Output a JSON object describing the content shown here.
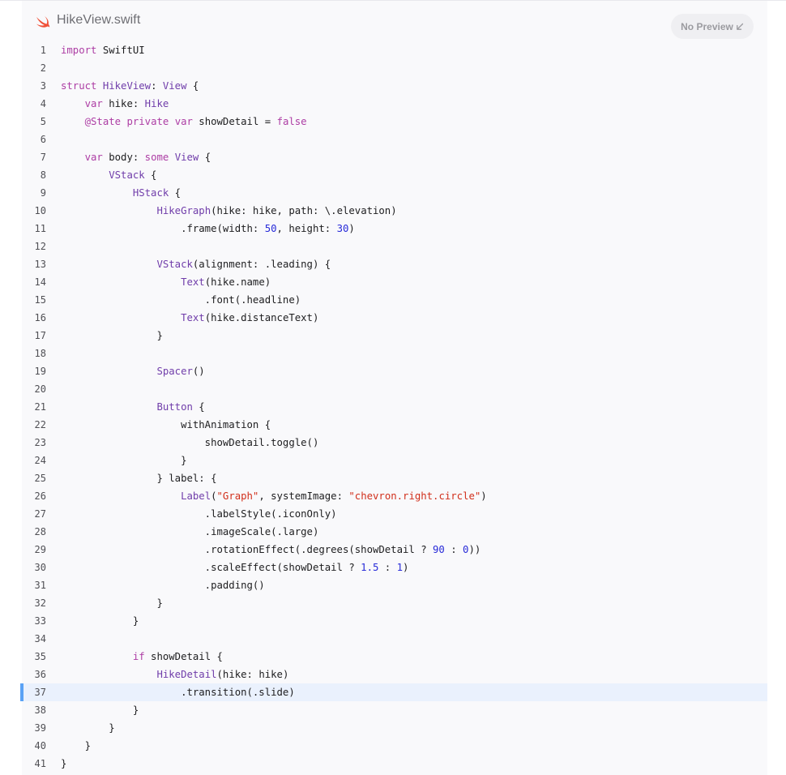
{
  "file": {
    "name": "HikeView.swift",
    "icon": "swift-logo-icon",
    "icon_color": "#f05138"
  },
  "preview_button": {
    "label": "No Preview",
    "icon": "arrow-down-left-icon"
  },
  "colors": {
    "keyword": "#ad3da4",
    "type": "#703daa",
    "string": "#d12f1b",
    "number": "#272ad8",
    "plain": "#1d1d1f",
    "highlight_bg": "#eaf1fd",
    "highlight_bar": "#5aa2f5"
  },
  "highlighted_line": 37,
  "lines": [
    {
      "n": "1",
      "tokens": [
        {
          "t": "import",
          "k": "kw"
        },
        {
          "t": " SwiftUI",
          "k": "plain"
        }
      ]
    },
    {
      "n": "2",
      "tokens": []
    },
    {
      "n": "3",
      "tokens": [
        {
          "t": "struct",
          "k": "kw"
        },
        {
          "t": " ",
          "k": "plain"
        },
        {
          "t": "HikeView",
          "k": "type"
        },
        {
          "t": ": ",
          "k": "plain"
        },
        {
          "t": "View",
          "k": "type"
        },
        {
          "t": " {",
          "k": "plain"
        }
      ]
    },
    {
      "n": "4",
      "tokens": [
        {
          "t": "    ",
          "k": "plain"
        },
        {
          "t": "var",
          "k": "kw"
        },
        {
          "t": " hike: ",
          "k": "plain"
        },
        {
          "t": "Hike",
          "k": "type"
        }
      ]
    },
    {
      "n": "5",
      "tokens": [
        {
          "t": "    ",
          "k": "plain"
        },
        {
          "t": "@State",
          "k": "kw"
        },
        {
          "t": " ",
          "k": "plain"
        },
        {
          "t": "private",
          "k": "kw"
        },
        {
          "t": " ",
          "k": "plain"
        },
        {
          "t": "var",
          "k": "kw"
        },
        {
          "t": " showDetail = ",
          "k": "plain"
        },
        {
          "t": "false",
          "k": "kw"
        }
      ]
    },
    {
      "n": "6",
      "tokens": []
    },
    {
      "n": "7",
      "tokens": [
        {
          "t": "    ",
          "k": "plain"
        },
        {
          "t": "var",
          "k": "kw"
        },
        {
          "t": " body: ",
          "k": "plain"
        },
        {
          "t": "some",
          "k": "kw"
        },
        {
          "t": " ",
          "k": "plain"
        },
        {
          "t": "View",
          "k": "type"
        },
        {
          "t": " {",
          "k": "plain"
        }
      ]
    },
    {
      "n": "8",
      "tokens": [
        {
          "t": "        ",
          "k": "plain"
        },
        {
          "t": "VStack",
          "k": "type"
        },
        {
          "t": " {",
          "k": "plain"
        }
      ]
    },
    {
      "n": "9",
      "tokens": [
        {
          "t": "            ",
          "k": "plain"
        },
        {
          "t": "HStack",
          "k": "type"
        },
        {
          "t": " {",
          "k": "plain"
        }
      ]
    },
    {
      "n": "10",
      "tokens": [
        {
          "t": "                ",
          "k": "plain"
        },
        {
          "t": "HikeGraph",
          "k": "type"
        },
        {
          "t": "(hike: hike, path: \\.elevation)",
          "k": "plain"
        }
      ]
    },
    {
      "n": "11",
      "tokens": [
        {
          "t": "                    .frame(width: ",
          "k": "plain"
        },
        {
          "t": "50",
          "k": "num"
        },
        {
          "t": ", height: ",
          "k": "plain"
        },
        {
          "t": "30",
          "k": "num"
        },
        {
          "t": ")",
          "k": "plain"
        }
      ]
    },
    {
      "n": "12",
      "tokens": []
    },
    {
      "n": "13",
      "tokens": [
        {
          "t": "                ",
          "k": "plain"
        },
        {
          "t": "VStack",
          "k": "type"
        },
        {
          "t": "(alignment: .leading) {",
          "k": "plain"
        }
      ]
    },
    {
      "n": "14",
      "tokens": [
        {
          "t": "                    ",
          "k": "plain"
        },
        {
          "t": "Text",
          "k": "type"
        },
        {
          "t": "(hike.name)",
          "k": "plain"
        }
      ]
    },
    {
      "n": "15",
      "tokens": [
        {
          "t": "                        .font(.headline)",
          "k": "plain"
        }
      ]
    },
    {
      "n": "16",
      "tokens": [
        {
          "t": "                    ",
          "k": "plain"
        },
        {
          "t": "Text",
          "k": "type"
        },
        {
          "t": "(hike.distanceText)",
          "k": "plain"
        }
      ]
    },
    {
      "n": "17",
      "tokens": [
        {
          "t": "                }",
          "k": "plain"
        }
      ]
    },
    {
      "n": "18",
      "tokens": []
    },
    {
      "n": "19",
      "tokens": [
        {
          "t": "                ",
          "k": "plain"
        },
        {
          "t": "Spacer",
          "k": "type"
        },
        {
          "t": "()",
          "k": "plain"
        }
      ]
    },
    {
      "n": "20",
      "tokens": []
    },
    {
      "n": "21",
      "tokens": [
        {
          "t": "                ",
          "k": "plain"
        },
        {
          "t": "Button",
          "k": "type"
        },
        {
          "t": " {",
          "k": "plain"
        }
      ]
    },
    {
      "n": "22",
      "tokens": [
        {
          "t": "                    withAnimation {",
          "k": "plain"
        }
      ]
    },
    {
      "n": "23",
      "tokens": [
        {
          "t": "                        showDetail.toggle()",
          "k": "plain"
        }
      ]
    },
    {
      "n": "24",
      "tokens": [
        {
          "t": "                    }",
          "k": "plain"
        }
      ]
    },
    {
      "n": "25",
      "tokens": [
        {
          "t": "                } label: {",
          "k": "plain"
        }
      ]
    },
    {
      "n": "26",
      "tokens": [
        {
          "t": "                    ",
          "k": "plain"
        },
        {
          "t": "Label",
          "k": "type"
        },
        {
          "t": "(",
          "k": "plain"
        },
        {
          "t": "\"Graph\"",
          "k": "str"
        },
        {
          "t": ", systemImage: ",
          "k": "plain"
        },
        {
          "t": "\"chevron.right.circle\"",
          "k": "str"
        },
        {
          "t": ")",
          "k": "plain"
        }
      ]
    },
    {
      "n": "27",
      "tokens": [
        {
          "t": "                        .labelStyle(.iconOnly)",
          "k": "plain"
        }
      ]
    },
    {
      "n": "28",
      "tokens": [
        {
          "t": "                        .imageScale(.large)",
          "k": "plain"
        }
      ]
    },
    {
      "n": "29",
      "tokens": [
        {
          "t": "                        .rotationEffect(.degrees(showDetail ? ",
          "k": "plain"
        },
        {
          "t": "90",
          "k": "num"
        },
        {
          "t": " : ",
          "k": "plain"
        },
        {
          "t": "0",
          "k": "num"
        },
        {
          "t": "))",
          "k": "plain"
        }
      ]
    },
    {
      "n": "30",
      "tokens": [
        {
          "t": "                        .scaleEffect(showDetail ? ",
          "k": "plain"
        },
        {
          "t": "1.5",
          "k": "num"
        },
        {
          "t": " : ",
          "k": "plain"
        },
        {
          "t": "1",
          "k": "num"
        },
        {
          "t": ")",
          "k": "plain"
        }
      ]
    },
    {
      "n": "31",
      "tokens": [
        {
          "t": "                        .padding()",
          "k": "plain"
        }
      ]
    },
    {
      "n": "32",
      "tokens": [
        {
          "t": "                }",
          "k": "plain"
        }
      ]
    },
    {
      "n": "33",
      "tokens": [
        {
          "t": "            }",
          "k": "plain"
        }
      ]
    },
    {
      "n": "34",
      "tokens": []
    },
    {
      "n": "35",
      "tokens": [
        {
          "t": "            ",
          "k": "plain"
        },
        {
          "t": "if",
          "k": "kw"
        },
        {
          "t": " showDetail {",
          "k": "plain"
        }
      ]
    },
    {
      "n": "36",
      "tokens": [
        {
          "t": "                ",
          "k": "plain"
        },
        {
          "t": "HikeDetail",
          "k": "type"
        },
        {
          "t": "(hike: hike)",
          "k": "plain"
        }
      ]
    },
    {
      "n": "37",
      "tokens": [
        {
          "t": "                    .transition(.slide)",
          "k": "plain"
        }
      ]
    },
    {
      "n": "38",
      "tokens": [
        {
          "t": "            }",
          "k": "plain"
        }
      ]
    },
    {
      "n": "39",
      "tokens": [
        {
          "t": "        }",
          "k": "plain"
        }
      ]
    },
    {
      "n": "40",
      "tokens": [
        {
          "t": "    }",
          "k": "plain"
        }
      ]
    },
    {
      "n": "41",
      "tokens": [
        {
          "t": "}",
          "k": "plain"
        }
      ]
    }
  ]
}
